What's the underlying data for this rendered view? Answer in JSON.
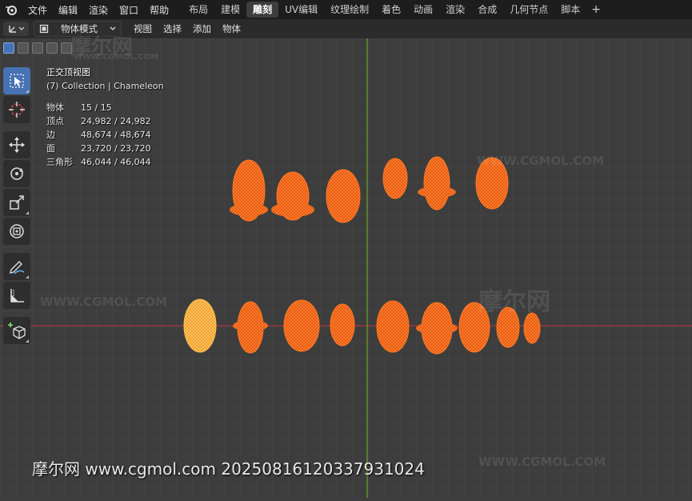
{
  "menu": {
    "items": [
      "文件",
      "编辑",
      "渲染",
      "窗口",
      "帮助"
    ]
  },
  "workspaces": {
    "tabs": [
      "布局",
      "建模",
      "雕刻",
      "UV编辑",
      "纹理绘制",
      "着色",
      "动画",
      "渲染",
      "合成",
      "几何节点",
      "脚本"
    ],
    "active": "雕刻",
    "add_label": "+"
  },
  "header": {
    "mode_label": "物体模式",
    "menus": [
      "视图",
      "选择",
      "添加",
      "物体"
    ]
  },
  "overlay": {
    "view_name": "正交顶视图",
    "collection": "(7) Collection | Chameleon",
    "stats": [
      {
        "label": "物体",
        "value": "15 / 15"
      },
      {
        "label": "顶点",
        "value": "24,982 / 24,982"
      },
      {
        "label": "边",
        "value": "48,674 / 48,674"
      },
      {
        "label": "面",
        "value": "23,720 / 23,720"
      },
      {
        "label": "三角形",
        "value": "46,044 / 46,044"
      }
    ]
  },
  "tools": [
    "select-box-icon",
    "cursor-icon",
    "move-icon",
    "rotate-icon",
    "scale-icon",
    "transform-icon",
    "annotate-icon",
    "measure-icon",
    "add-cube-icon"
  ],
  "colors": {
    "accent": "#4772b3",
    "selected_mesh": "#ff6a1a",
    "active_mesh": "#ffaa3a",
    "x_axis": "#a8343a",
    "y_axis": "#6a9a2a"
  },
  "watermark": {
    "logo_text": "摩尔网",
    "site": "WWW.CGMOL.COM",
    "footer": "摩尔网 www.cgmol.com 20250816120337931024"
  }
}
